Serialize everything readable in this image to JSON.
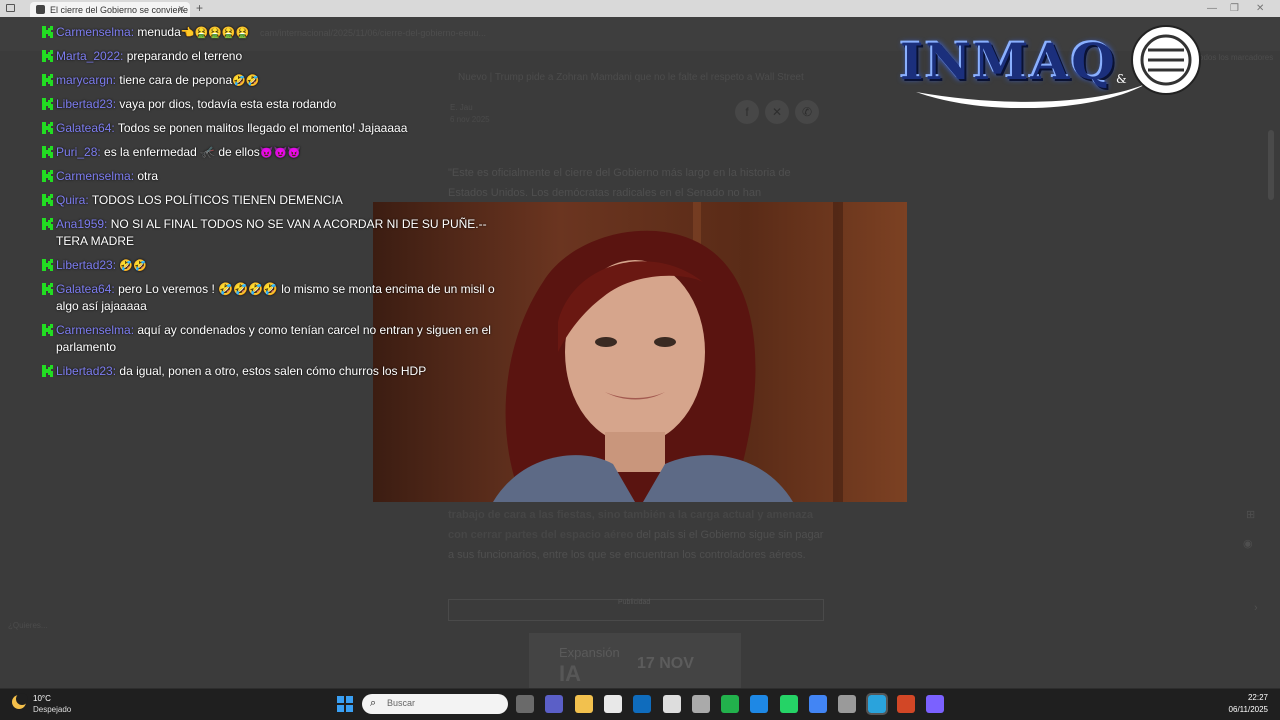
{
  "browser": {
    "tab_title": "El cierre del Gobierno se convierte",
    "url_text": "cam/internacional/2025/11/06/cierre-del-gobierno-eeuu...",
    "bookmark_right": "Todos los marcadores",
    "status_text": "¿Quieres..."
  },
  "article": {
    "breadcrumb": "Nuevo | Trump pide a Zohran Mamdani que no le falte el respeto a Wall Street",
    "byline": "E. Jau",
    "byline_date": "6 nov 2025",
    "para1": "\"Este es oficialmente el cierre del Gobierno más largo en la historia de Estados Unidos. Los demócratas radicales en el Senado no han",
    "para2_bold": "trabajo de cara a las fiestas, sino también a la carga actual y amenaza con cerrar partes del espacio aéreo",
    "para2_rest": " del país si el Gobierno sigue sin pagar a sus funcionarios, entre los que se encuentran los controladores aéreos.",
    "ad_label": "Publicidad",
    "ad_brand": "Expansión",
    "ad_big": "IA",
    "ad_date": "17 NOV"
  },
  "chat": {
    "messages": [
      {
        "user": "Carmenselma:",
        "text": "menuda",
        "emoji": "👈🤮🤮🤮🤮"
      },
      {
        "user": "Marta_2022:",
        "text": "preparando el terreno",
        "emoji": ""
      },
      {
        "user": "marycargn:",
        "text": "tiene cara de pepona",
        "emoji": "🤣🤣"
      },
      {
        "user": "Libertad23:",
        "text": "vaya por dios, todavía esta esta rodando",
        "emoji": ""
      },
      {
        "user": "Galatea64:",
        "text": "Todos se ponen malitos llegado el momento! Jajaaaaa",
        "emoji": ""
      },
      {
        "user": "Puri_28:",
        "text": "es la enfermedad 🦟 de ellos",
        "emoji": "😈😈😈"
      },
      {
        "user": "Carmenselma:",
        "text": "otra",
        "emoji": ""
      },
      {
        "user": "Quira:",
        "text": "TODOS LOS POLÍTICOS TIENEN DEMENCIA",
        "emoji": ""
      },
      {
        "user": "Ana1959:",
        "text": "NO SI AL FINAL TODOS NO SE VAN A ACORDAR NI DE SU PUÑE.--TERA MADRE",
        "emoji": ""
      },
      {
        "user": "Libertad23:",
        "text": "",
        "emoji": "🤣🤣"
      },
      {
        "user": "Galatea64:",
        "text": "pero Lo veremos ! 🤣🤣🤣🤣 lo mismo se monta encima de un misil o algo así jajaaaaa",
        "emoji": ""
      },
      {
        "user": "Carmenselma:",
        "text": "aquí ay condenados y como tenían carcel no entran y siguen en el parlamento",
        "emoji": ""
      },
      {
        "user": "Libertad23:",
        "text": "da igual, ponen a otro, estos salen cómo churros los HDP",
        "emoji": ""
      }
    ]
  },
  "logo": {
    "text": "INMAQ",
    "amp": "&"
  },
  "taskbar": {
    "weather_temp": "10°C",
    "weather_desc": "Despejado",
    "search_placeholder": "Buscar",
    "time": "22:27",
    "date": "06/11/2025",
    "icons": [
      "task-view-icon",
      "teams-icon",
      "file-explorer-icon",
      "store-icon",
      "outlook-icon",
      "chatgpt-icon",
      "app-icon",
      "camtasia-icon",
      "edge-icon",
      "whatsapp-icon",
      "chrome-icon",
      "app2-icon",
      "telegram-icon",
      "powerpoint-icon",
      "app3-icon"
    ]
  },
  "colors": {
    "username": "#7d7df0",
    "badge": "#22dd22",
    "accent": "#3aa0f4"
  }
}
